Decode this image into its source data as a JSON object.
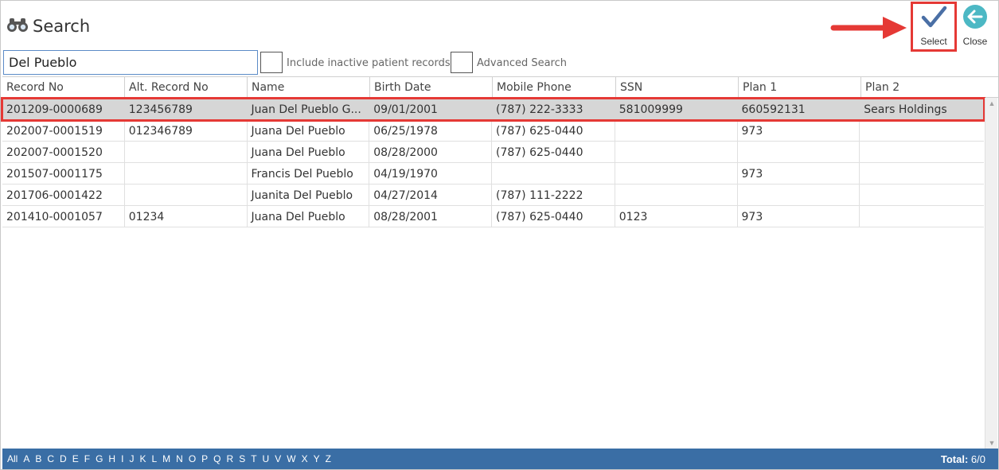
{
  "window": {
    "title": "Search"
  },
  "actions": {
    "select_label": "Select",
    "close_label": "Close"
  },
  "search": {
    "value": "Del Pueblo",
    "include_inactive_label": "Include inactive patient records.",
    "advanced_label": "Advanced Search"
  },
  "grid": {
    "columns": [
      "Record No",
      "Alt. Record No",
      "Name",
      "Birth Date",
      "Mobile Phone",
      "SSN",
      "Plan 1",
      "Plan 2"
    ],
    "rows": [
      [
        "201209-0000689",
        "123456789",
        "Juan Del Pueblo G...",
        "09/01/2001",
        "(787) 222-3333",
        "581009999",
        "660592131",
        "Sears Holdings"
      ],
      [
        "202007-0001519",
        "012346789",
        "Juana Del Pueblo",
        "06/25/1978",
        "(787) 625-0440",
        "",
        "973",
        ""
      ],
      [
        "202007-0001520",
        "",
        "Juana Del Pueblo",
        "08/28/2000",
        "(787) 625-0440",
        "",
        "",
        ""
      ],
      [
        "201507-0001175",
        "",
        "Francis Del Pueblo",
        "04/19/1970",
        "",
        "",
        "973",
        ""
      ],
      [
        "201706-0001422",
        "",
        "Juanita Del Pueblo",
        "04/27/2014",
        "(787) 111-2222",
        "",
        "",
        ""
      ],
      [
        "201410-0001057",
        "01234",
        "Juana Del Pueblo",
        "08/28/2001",
        "(787) 625-0440",
        "0123",
        "973",
        ""
      ]
    ],
    "selected_row": 0
  },
  "footer": {
    "letters": [
      "All",
      "A",
      "B",
      "C",
      "D",
      "E",
      "F",
      "G",
      "H",
      "I",
      "J",
      "K",
      "L",
      "M",
      "N",
      "O",
      "P",
      "Q",
      "R",
      "S",
      "T",
      "U",
      "V",
      "W",
      "X",
      "Y",
      "Z"
    ],
    "total_label": "Total:",
    "total_value": "6/0"
  },
  "colors": {
    "accent": "#3a6ea5",
    "highlight": "#e53935",
    "checkmark": "#4a6fa5",
    "close": "#4cb8c4"
  },
  "icons": {
    "title": "binoculars-icon",
    "select": "checkmark-icon",
    "close": "back-arrow-icon",
    "annotation": "red-arrow-icon"
  }
}
